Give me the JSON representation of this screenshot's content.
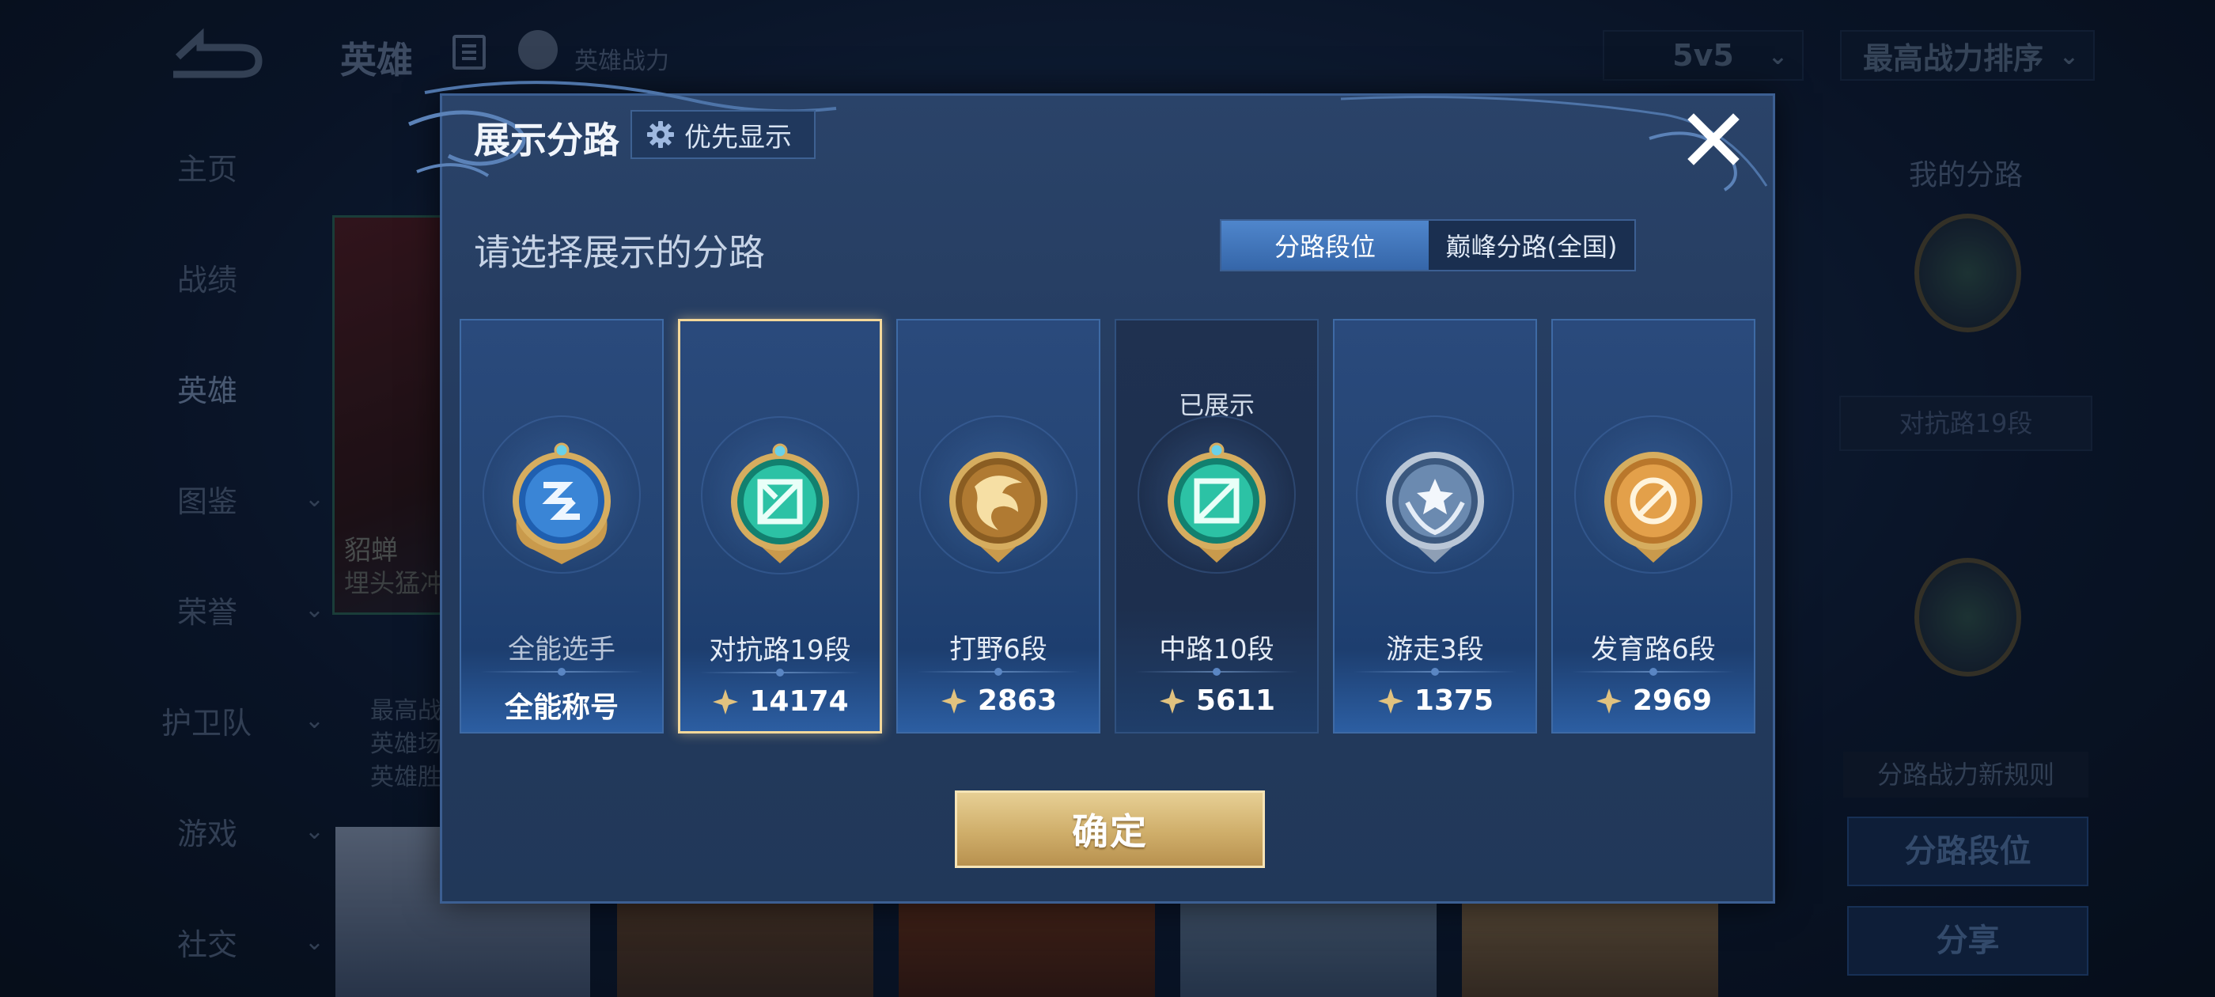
{
  "background": {
    "top_title": "英雄",
    "power_label": "英雄战力",
    "mode_select": "5v5",
    "sort_select": "最高战力排序",
    "nav": [
      {
        "label": "主页",
        "has_chevron": false
      },
      {
        "label": "战绩",
        "has_chevron": false
      },
      {
        "label": "英雄",
        "has_chevron": false,
        "active": true
      },
      {
        "label": "图鉴",
        "has_chevron": true
      },
      {
        "label": "荣誉",
        "has_chevron": true
      },
      {
        "label": "护卫队",
        "has_chevron": true
      },
      {
        "label": "游戏",
        "has_chevron": true
      },
      {
        "label": "社交",
        "has_chevron": true
      }
    ],
    "hero_card": {
      "name": "貂蝉",
      "subtitle": "埋头猛冲"
    },
    "hero_stats": [
      "最高战",
      "英雄场",
      "英雄胜"
    ],
    "right_panel": {
      "title": "我的分路",
      "rank_text": "对抗路19段",
      "rule_text": "分路战力新规则",
      "button_1": "分路段位",
      "button_2": "分享"
    }
  },
  "modal": {
    "title": "展示分路",
    "priority_button": "优先显示",
    "subtitle": "请选择展示的分路",
    "tabs": [
      {
        "label": "分路段位",
        "active": true
      },
      {
        "label": "巅峰分路(全国)",
        "active": false
      }
    ],
    "cards": [
      {
        "rank": "全能选手",
        "score": "全能称号",
        "status": "",
        "badge": "allround-badge-icon",
        "selected": false,
        "dim": false,
        "has_score_icon": false
      },
      {
        "rank": "对抗路19段",
        "score": "14174",
        "status": "",
        "badge": "clash-lane-badge-icon",
        "selected": true,
        "dim": false,
        "has_score_icon": true
      },
      {
        "rank": "打野6段",
        "score": "2863",
        "status": "",
        "badge": "jungle-badge-icon",
        "selected": false,
        "dim": false,
        "has_score_icon": true
      },
      {
        "rank": "中路10段",
        "score": "5611",
        "status": "已展示",
        "badge": "mid-lane-badge-icon",
        "selected": false,
        "dim": true,
        "has_score_icon": true
      },
      {
        "rank": "游走3段",
        "score": "1375",
        "status": "",
        "badge": "roam-badge-icon",
        "selected": false,
        "dim": false,
        "has_score_icon": true
      },
      {
        "rank": "发育路6段",
        "score": "2969",
        "status": "",
        "badge": "farm-lane-badge-icon",
        "selected": false,
        "dim": false,
        "has_score_icon": true
      }
    ],
    "confirm_button": "确定"
  },
  "colors": {
    "selected_border": "#f3d89a",
    "confirm_gold": "#cfae6a",
    "tab_active": "#3f75bb"
  }
}
